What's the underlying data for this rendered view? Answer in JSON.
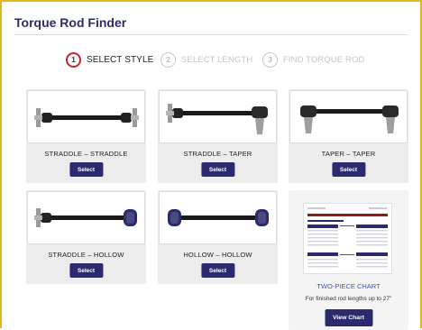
{
  "header": {
    "title": "Torque Rod Finder"
  },
  "steps": [
    {
      "number": "1",
      "label": "SELECT STYLE",
      "state": "active"
    },
    {
      "number": "2",
      "label": "SELECT LENGTH",
      "state": "inactive"
    },
    {
      "number": "3",
      "label": "FIND TORQUE ROD",
      "state": "inactive"
    }
  ],
  "styles": [
    {
      "name": "STRADDLE – STRADDLE",
      "button": "Select",
      "icon": "straddle-straddle-rod-icon"
    },
    {
      "name": "STRADDLE – TAPER",
      "button": "Select",
      "icon": "straddle-taper-rod-icon"
    },
    {
      "name": "TAPER – TAPER",
      "button": "Select",
      "icon": "taper-taper-rod-icon"
    },
    {
      "name": "STRADDLE – HOLLOW",
      "button": "Select",
      "icon": "straddle-hollow-rod-icon"
    },
    {
      "name": "HOLLOW – HOLLOW",
      "button": "Select",
      "icon": "hollow-hollow-rod-icon"
    }
  ],
  "chart_card": {
    "name": "TWO-PIECE CHART",
    "description": "For finished rod lengths up to 27\"",
    "button": "View Chart",
    "icon": "two-piece-chart-thumbnail"
  },
  "colors": {
    "brand_navy": "#2b2a6e",
    "accent_gold": "#e3b51b",
    "active_step": "#c62828",
    "link_blue": "#3f57b5"
  }
}
